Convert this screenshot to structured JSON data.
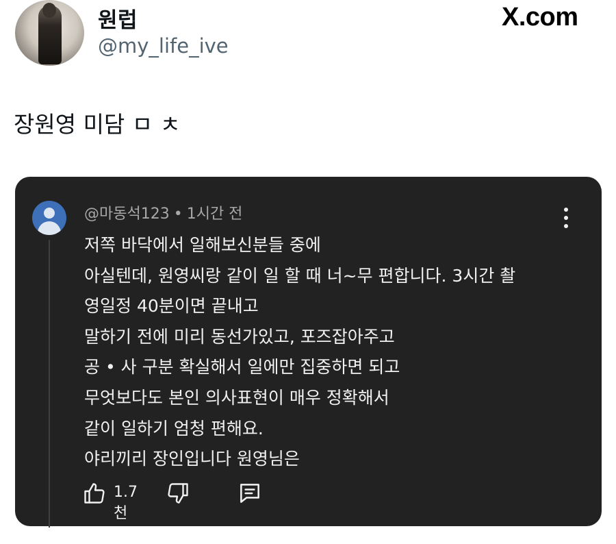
{
  "tweet": {
    "display_name": "원럽",
    "handle": "@my_life_ive",
    "brand": "X.com",
    "text": "장원영 미담 ㅁ ㅊ"
  },
  "comment": {
    "author": "@마동석123",
    "time": "1시간 전",
    "lines": [
      "저쪽 바닥에서 일해보신분들 중에",
      "아실텐데, 원영씨랑 같이 일 할 때 너~무 편합니다. 3시간 촬",
      "영일정 40분이면 끝내고",
      "말하기 전에 미리 동선가있고, 포즈잡아주고",
      "공 • 사 구분 확실해서 일에만 집중하면 되고",
      "무엇보다도 본인 의사표현이 매우 정확해서",
      "같이 일하기 엄청 편해요.",
      "야리끼리 장인입니다 원영님은"
    ],
    "like_count": "1.7천"
  },
  "icons": {
    "avatar": "profile-photo",
    "comment_avatar": "default-user-icon",
    "more": "more-vertical-icon",
    "like": "thumbs-up-icon",
    "dislike": "thumbs-down-icon",
    "reply": "comment-icon"
  },
  "colors": {
    "card_bg": "#222222",
    "comment_text": "#f1f1f1",
    "meta_text": "#a8a8a8",
    "handle_text": "#536471",
    "comment_avatar": "#3d70b8"
  }
}
